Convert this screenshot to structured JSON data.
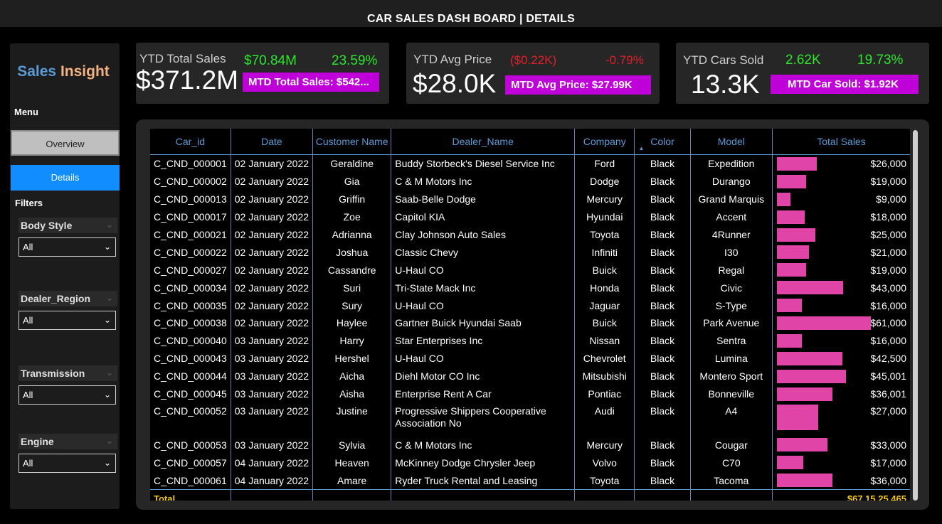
{
  "title": "CAR SALES DASH BOARD | DETAILS",
  "sidebar": {
    "brand_1": "Sales",
    "brand_2": "Insight",
    "menu_label": "Menu",
    "overview": "Overview",
    "details": "Details",
    "filters_label": "Filters",
    "filters": [
      {
        "label": "Body Style",
        "value": "All"
      },
      {
        "label": "Dealer_Region",
        "value": "All"
      },
      {
        "label": "Transmission",
        "value": "All"
      },
      {
        "label": "Engine",
        "value": "All"
      }
    ]
  },
  "kpis": [
    {
      "label": "YTD Total Sales",
      "value": "$371.2M",
      "delta_abs": "$70.84M",
      "delta_pct": "23.59%",
      "mtd": "MTD Total Sales: $542...",
      "trend": "up"
    },
    {
      "label": "YTD Avg Price",
      "value": "$28.0K",
      "delta_abs": "($0.22K)",
      "delta_pct": "-0.79%",
      "mtd": "MTD Avg Price: $27.99K",
      "trend": "down"
    },
    {
      "label": "YTD Cars Sold",
      "value": "13.3K",
      "delta_abs": "2.62K",
      "delta_pct": "19.73%",
      "mtd": "MTD Car Sold: $1.92K",
      "trend": "up"
    }
  ],
  "colors": {
    "positive": "#2ee52e",
    "negative": "#e0202a",
    "mtd_badge": "#c000d8",
    "bar": "#e044a7",
    "header": "#5b9bd5",
    "total": "#f2c811"
  },
  "table": {
    "columns": [
      "Car_id",
      "Date",
      "Customer Name",
      "Dealer_Name",
      "Company",
      "Color",
      "Model",
      "Total Sales"
    ],
    "rows": [
      {
        "car_id": "C_CND_000001",
        "date": "02 January 2022",
        "customer": "Geraldine",
        "dealer": "Buddy Storbeck's Diesel Service Inc",
        "company": "Ford",
        "color": "Black",
        "model": "Expedition",
        "sales": "$26,000",
        "amount": 26000
      },
      {
        "car_id": "C_CND_000002",
        "date": "02 January 2022",
        "customer": "Gia",
        "dealer": "C & M Motors Inc",
        "company": "Dodge",
        "color": "Black",
        "model": "Durango",
        "sales": "$19,000",
        "amount": 19000
      },
      {
        "car_id": "C_CND_000013",
        "date": "02 January 2022",
        "customer": "Griffin",
        "dealer": "Saab-Belle Dodge",
        "company": "Mercury",
        "color": "Black",
        "model": "Grand Marquis",
        "sales": "$9,000",
        "amount": 9000
      },
      {
        "car_id": "C_CND_000017",
        "date": "02 January 2022",
        "customer": "Zoe",
        "dealer": "Capitol KIA",
        "company": "Hyundai",
        "color": "Black",
        "model": "Accent",
        "sales": "$18,000",
        "amount": 18000
      },
      {
        "car_id": "C_CND_000021",
        "date": "02 January 2022",
        "customer": "Adrianna",
        "dealer": "Clay Johnson Auto Sales",
        "company": "Toyota",
        "color": "Black",
        "model": "4Runner",
        "sales": "$25,000",
        "amount": 25000
      },
      {
        "car_id": "C_CND_000022",
        "date": "02 January 2022",
        "customer": "Joshua",
        "dealer": "Classic Chevy",
        "company": "Infiniti",
        "color": "Black",
        "model": "I30",
        "sales": "$21,000",
        "amount": 21000
      },
      {
        "car_id": "C_CND_000027",
        "date": "02 January 2022",
        "customer": "Cassandre",
        "dealer": "U-Haul CO",
        "company": "Buick",
        "color": "Black",
        "model": "Regal",
        "sales": "$19,000",
        "amount": 19000
      },
      {
        "car_id": "C_CND_000034",
        "date": "02 January 2022",
        "customer": "Suri",
        "dealer": "Tri-State Mack Inc",
        "company": "Honda",
        "color": "Black",
        "model": "Civic",
        "sales": "$43,000",
        "amount": 43000
      },
      {
        "car_id": "C_CND_000035",
        "date": "02 January 2022",
        "customer": "Sury",
        "dealer": "U-Haul CO",
        "company": "Jaguar",
        "color": "Black",
        "model": "S-Type",
        "sales": "$16,000",
        "amount": 16000
      },
      {
        "car_id": "C_CND_000038",
        "date": "02 January 2022",
        "customer": "Haylee",
        "dealer": "Gartner Buick Hyundai Saab",
        "company": "Buick",
        "color": "Black",
        "model": "Park Avenue",
        "sales": "$61,000",
        "amount": 61000
      },
      {
        "car_id": "C_CND_000040",
        "date": "03 January 2022",
        "customer": "Harry",
        "dealer": "Star Enterprises Inc",
        "company": "Nissan",
        "color": "Black",
        "model": "Sentra",
        "sales": "$16,000",
        "amount": 16000
      },
      {
        "car_id": "C_CND_000043",
        "date": "03 January 2022",
        "customer": "Hershel",
        "dealer": "U-Haul CO",
        "company": "Chevrolet",
        "color": "Black",
        "model": "Lumina",
        "sales": "$42,500",
        "amount": 42500
      },
      {
        "car_id": "C_CND_000044",
        "date": "03 January 2022",
        "customer": "Aicha",
        "dealer": "Diehl Motor CO Inc",
        "company": "Mitsubishi",
        "color": "Black",
        "model": "Montero Sport",
        "sales": "$45,001",
        "amount": 45001
      },
      {
        "car_id": "C_CND_000045",
        "date": "03 January 2022",
        "customer": "Aisha",
        "dealer": "Enterprise Rent A Car",
        "company": "Pontiac",
        "color": "Black",
        "model": "Bonneville",
        "sales": "$36,001",
        "amount": 36001
      },
      {
        "car_id": "C_CND_000052",
        "date": "03 January 2022",
        "customer": "Justine",
        "dealer": "Progressive Shippers Cooperative Association No",
        "company": "Audi",
        "color": "Black",
        "model": "A4",
        "sales": "$27,000",
        "amount": 27000,
        "tall": true
      },
      {
        "car_id": "C_CND_000053",
        "date": "03 January 2022",
        "customer": "Sylvia",
        "dealer": "C & M Motors Inc",
        "company": "Mercury",
        "color": "Black",
        "model": "Cougar",
        "sales": "$33,000",
        "amount": 33000
      },
      {
        "car_id": "C_CND_000057",
        "date": "04 January 2022",
        "customer": "Heaven",
        "dealer": "McKinney Dodge Chrysler Jeep",
        "company": "Volvo",
        "color": "Black",
        "model": "C70",
        "sales": "$17,000",
        "amount": 17000
      },
      {
        "car_id": "C_CND_000061",
        "date": "04 January 2022",
        "customer": "Amare",
        "dealer": "Ryder Truck Rental and Leasing",
        "company": "Toyota",
        "color": "Black",
        "model": "Tacoma",
        "sales": "$36,000",
        "amount": 36000
      }
    ],
    "total_label": "Total",
    "total_value": "$67,15,25,465",
    "bar_max": 61000
  }
}
